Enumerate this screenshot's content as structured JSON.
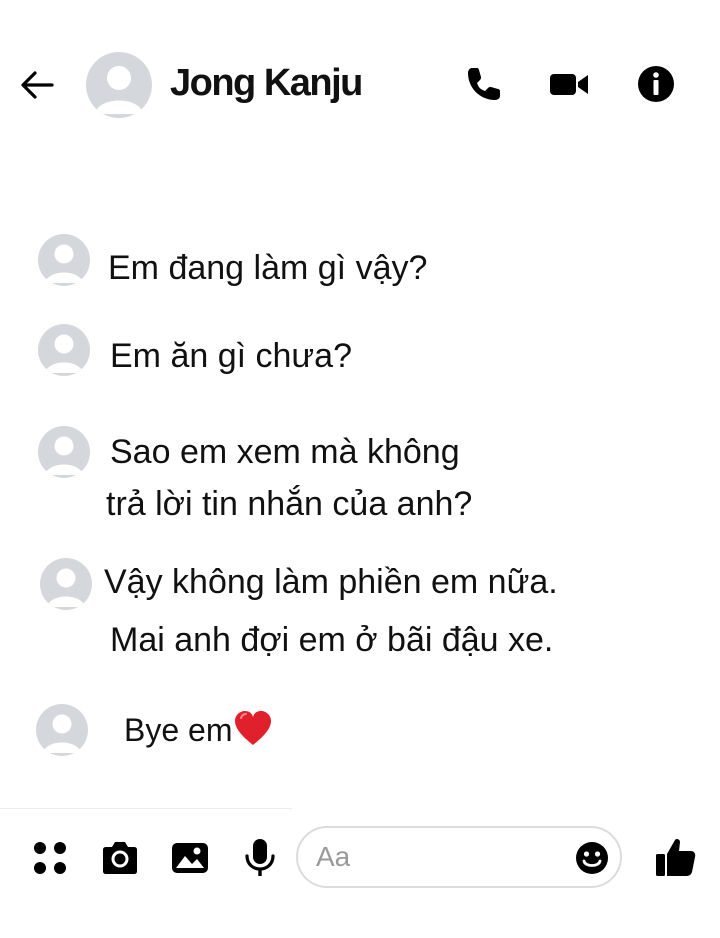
{
  "header": {
    "contact_name": "Jong Kanju",
    "icons": [
      "back-arrow-icon",
      "avatar",
      "phone-icon",
      "video-camera-icon",
      "info-icon"
    ]
  },
  "messages": [
    {
      "lines": [
        "Em đang làm gì vậy?"
      ]
    },
    {
      "lines": [
        "Em ăn gì chưa?"
      ]
    },
    {
      "lines": [
        "Sao em xem mà không",
        "trả lời tin nhắn của anh?"
      ]
    },
    {
      "lines": [
        "Vậy không làm phiền em nữa.",
        "Mai anh đợi em ở bãi đậu xe."
      ]
    },
    {
      "lines": [
        "Bye em"
      ],
      "emoji": "heart-icon"
    }
  ],
  "composer": {
    "placeholder": "Aa",
    "value": "",
    "icons": [
      "apps-icon",
      "camera-icon",
      "image-icon",
      "microphone-icon",
      "emoji-icon",
      "thumbs-up-icon"
    ]
  },
  "colors": {
    "icon": "#000000",
    "avatar_bg": "#d4d7dc",
    "avatar_fg": "#ffffff",
    "heart": "#e0202b"
  }
}
